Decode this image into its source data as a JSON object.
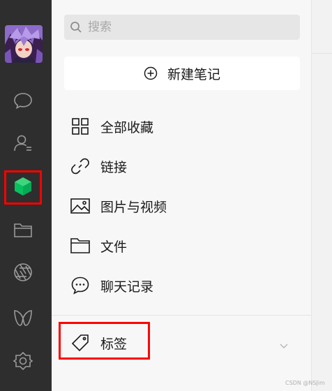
{
  "search": {
    "placeholder": "搜索"
  },
  "new_note": {
    "label": "新建笔记"
  },
  "menu": [
    {
      "label": "全部收藏",
      "icon": "grid-icon"
    },
    {
      "label": "链接",
      "icon": "link-icon"
    },
    {
      "label": "图片与视频",
      "icon": "image-icon"
    },
    {
      "label": "文件",
      "icon": "folder-icon"
    },
    {
      "label": "聊天记录",
      "icon": "chat-bubble-icon"
    }
  ],
  "tags": {
    "label": "标签",
    "icon": "tag-icon"
  },
  "sidebar": {
    "icons": [
      "chat-icon",
      "contacts-icon",
      "favorites-cube-icon",
      "files-folder-icon",
      "moments-aperture-icon",
      "channels-icon",
      "mini-programs-icon"
    ],
    "active": "favorites-cube-icon"
  },
  "colors": {
    "rail": "#2e2e2e",
    "active": "#07c160",
    "highlight": "#ff0000"
  },
  "watermark": "CSDN @NSJim"
}
